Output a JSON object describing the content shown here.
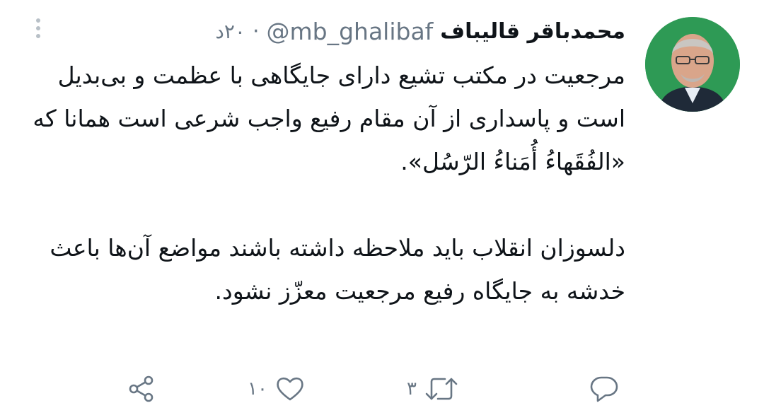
{
  "tweet": {
    "display_name": "محمدباقر قالیباف",
    "handle": "@mb_ghalibaf",
    "separator": "·",
    "timestamp": "۲۰د",
    "paragraph_1": "مرجعیت در مکتب تشیع دارای جایگاهی با عظمت و بی‌بدیل است و پاسداری از آن مقام رفیع واجب شرعی است همانا که «الفُقَهاءُ أُمَناءُ الرّسُل».",
    "paragraph_2": "دلسوزان انقلاب باید ملاحظه داشته باشند مواضع آن‌ها باعث خدشه به جایگاه رفیع مرجعیت معزّز نشود."
  },
  "actions": {
    "reply_count": "",
    "retweet_count": "۳",
    "like_count": "۱۰"
  },
  "colors": {
    "text": "#0f1419",
    "secondary": "#687684",
    "avatar_bg": "#2e9a55"
  },
  "icons": [
    "more-vertical-icon",
    "reply-icon",
    "retweet-icon",
    "like-icon",
    "share-icon"
  ]
}
